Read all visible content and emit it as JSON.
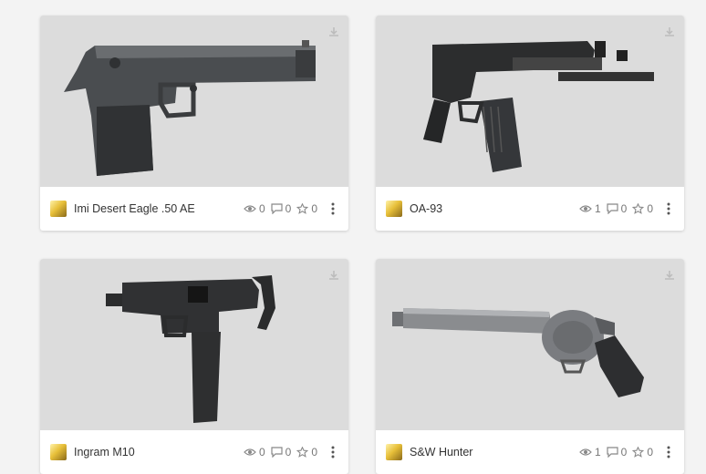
{
  "models": [
    {
      "title": "Imi Desert Eagle .50 AE",
      "views": "0",
      "comments": "0",
      "likes": "0",
      "icons": {
        "download": "download-icon",
        "views": "eye-icon",
        "comments": "comment-icon",
        "likes": "star-icon",
        "more": "more-vertical-icon"
      }
    },
    {
      "title": "OA-93",
      "views": "1",
      "comments": "0",
      "likes": "0",
      "icons": {
        "download": "download-icon",
        "views": "eye-icon",
        "comments": "comment-icon",
        "likes": "star-icon",
        "more": "more-vertical-icon"
      }
    },
    {
      "title": "Ingram M10",
      "views": "0",
      "comments": "0",
      "likes": "0",
      "icons": {
        "download": "download-icon",
        "views": "eye-icon",
        "comments": "comment-icon",
        "likes": "star-icon",
        "more": "more-vertical-icon"
      }
    },
    {
      "title": "S&W Hunter",
      "views": "1",
      "comments": "0",
      "likes": "0",
      "icons": {
        "download": "download-icon",
        "views": "eye-icon",
        "comments": "comment-icon",
        "likes": "star-icon",
        "more": "more-vertical-icon"
      }
    }
  ],
  "colors": {
    "thumb_bg": "#dcdcdc",
    "card_bg": "#ffffff",
    "page_bg": "#f3f3f3",
    "meta_text": "#777777"
  }
}
